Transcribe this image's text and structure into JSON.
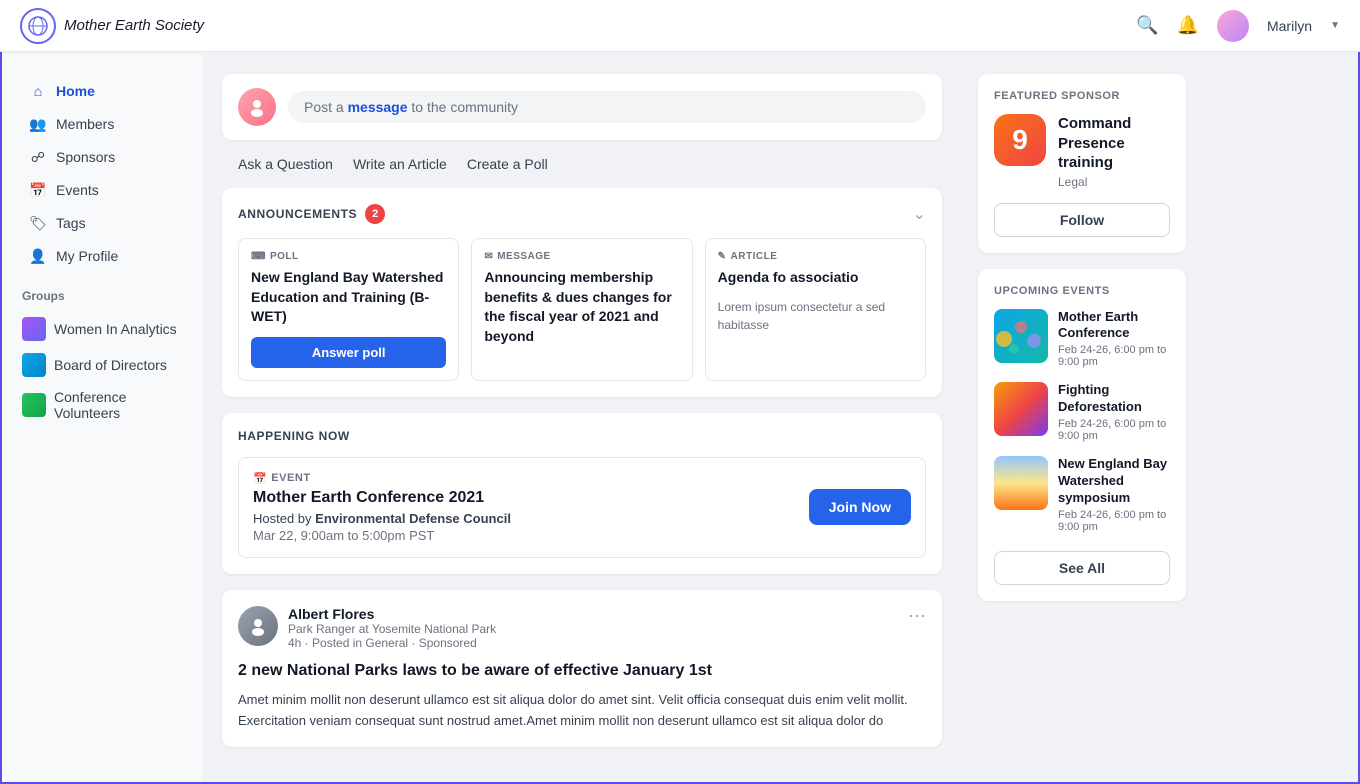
{
  "header": {
    "logo_text": "Mother Earth Society",
    "user_name": "Marilyn"
  },
  "sidebar": {
    "nav_items": [
      {
        "id": "home",
        "label": "Home",
        "active": true
      },
      {
        "id": "members",
        "label": "Members",
        "active": false
      },
      {
        "id": "sponsors",
        "label": "Sponsors",
        "active": false
      },
      {
        "id": "events",
        "label": "Events",
        "active": false
      },
      {
        "id": "tags",
        "label": "Tags",
        "active": false
      },
      {
        "id": "profile",
        "label": "My Profile",
        "active": false
      }
    ],
    "groups_label": "Groups",
    "groups": [
      {
        "id": "women-analytics",
        "label": "Women In Analytics"
      },
      {
        "id": "board-directors",
        "label": "Board of Directors"
      },
      {
        "id": "conf-volunteers",
        "label": "Conference Volunteers"
      }
    ]
  },
  "post_bar": {
    "placeholder_text": "Post a",
    "placeholder_link": "message",
    "placeholder_suffix": "to the community",
    "action1": "Ask a Question",
    "action2": "Write an Article",
    "action3": "Create a Poll"
  },
  "announcements": {
    "title": "ANNOUNCEMENTS",
    "count": "2",
    "items": [
      {
        "type": "POLL",
        "title": "New England Bay Watershed Education and Training (B-WET)",
        "action_label": "Answer poll"
      },
      {
        "type": "MESSAGE",
        "title": "Announcing membership benefits & dues changes for the fiscal year of 2021 and beyond"
      },
      {
        "type": "ARTICLE",
        "title": "Agenda fo associatio",
        "body": "Lorem ipsum consectetur a sed habitasse"
      }
    ]
  },
  "happening_now": {
    "title": "HAPPENING NOW",
    "event_type": "EVENT",
    "event_name": "Mother Earth Conference 2021",
    "event_host_pre": "Hosted by",
    "event_host": "Environmental Defense Council",
    "event_time": "Mar 22, 9:00am to 5:00pm PST",
    "join_label": "Join Now"
  },
  "post": {
    "author_name": "Albert Flores",
    "author_role": "Park Ranger at Yosemite National Park",
    "post_meta": "4h · Posted in General · Sponsored",
    "title": "2 new National Parks laws to be aware of effective January 1st",
    "body": "Amet minim mollit non deserunt ullamco est sit aliqua dolor do amet sint. Velit officia consequat duis enim velit mollit. Exercitation veniam consequat sunt nostrud amet.Amet minim mollit non deserunt ullamco est sit aliqua dolor do"
  },
  "featured_sponsor": {
    "label": "FEATURED SPONSOR",
    "name": "Command Presence training",
    "category": "Legal",
    "logo_number": "9",
    "follow_label": "Follow"
  },
  "upcoming_events": {
    "label": "UPCOMING EVENTS",
    "events": [
      {
        "name": "Mother Earth Conference",
        "date": "Feb 24-26, 6:00 pm to 9:00 pm",
        "thumb_type": "teal"
      },
      {
        "name": "Fighting Deforestation",
        "date": "Feb 24-26, 6:00 pm to 9:00 pm",
        "thumb_type": "sunset"
      },
      {
        "name": "New England Bay Watershed symposium",
        "date": "Feb 24-26, 6:00 pm to 9:00 pm",
        "thumb_type": "sky"
      }
    ],
    "see_all_label": "See All"
  }
}
